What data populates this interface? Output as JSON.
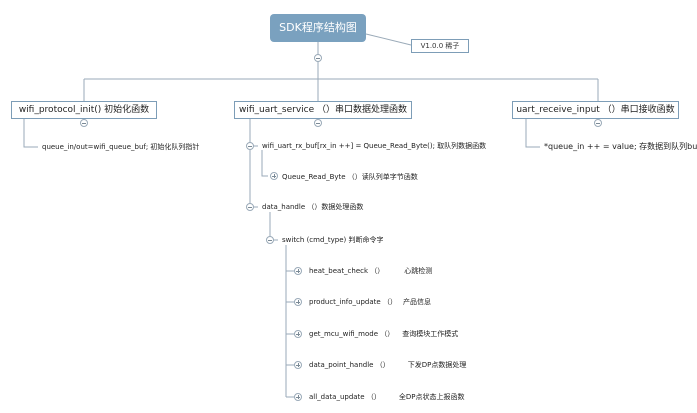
{
  "root": {
    "label": "SDK程序结构图"
  },
  "version_tag": "V1.0.0 稀子",
  "branches": {
    "init": {
      "label": "wifi_protocol_init() 初始化函数",
      "note": "queue_in/out=wifi_queue_buf;   初始化队列指针"
    },
    "service": {
      "label": "wifi_uart_service （）串口数据处理函数"
    },
    "receive": {
      "label": "uart_receive_input （）串口接收函数",
      "note": "*queue_in ++ = value; 存数据到队列buffer"
    }
  },
  "service_children": {
    "rx_buf": "wifi_uart_rx_buf[rx_in ++] = Queue_Read_Byte(); 取队列数据函数",
    "read_byte": "Queue_Read_Byte （）读队列单字节函数",
    "data_handle": "data_handle （）数据处理函数",
    "switch": "switch (cmd_type) 判断命令字"
  },
  "switch_cases": [
    {
      "func": "heat_beat_check （）",
      "desc": "心跳检测"
    },
    {
      "func": "product_info_update （）",
      "desc": "产品信息"
    },
    {
      "func": "get_mcu_wifi_mode （）",
      "desc": "查询模块工作模式"
    },
    {
      "func": "data_point_handle （）",
      "desc": "下发DP点数据处理"
    },
    {
      "func": "all_data_update （）",
      "desc": "全DP点状态上报函数"
    }
  ],
  "colors": {
    "root_fill": "#7aa1bf",
    "border": "#7d9db7",
    "line": "#9aaab8"
  }
}
